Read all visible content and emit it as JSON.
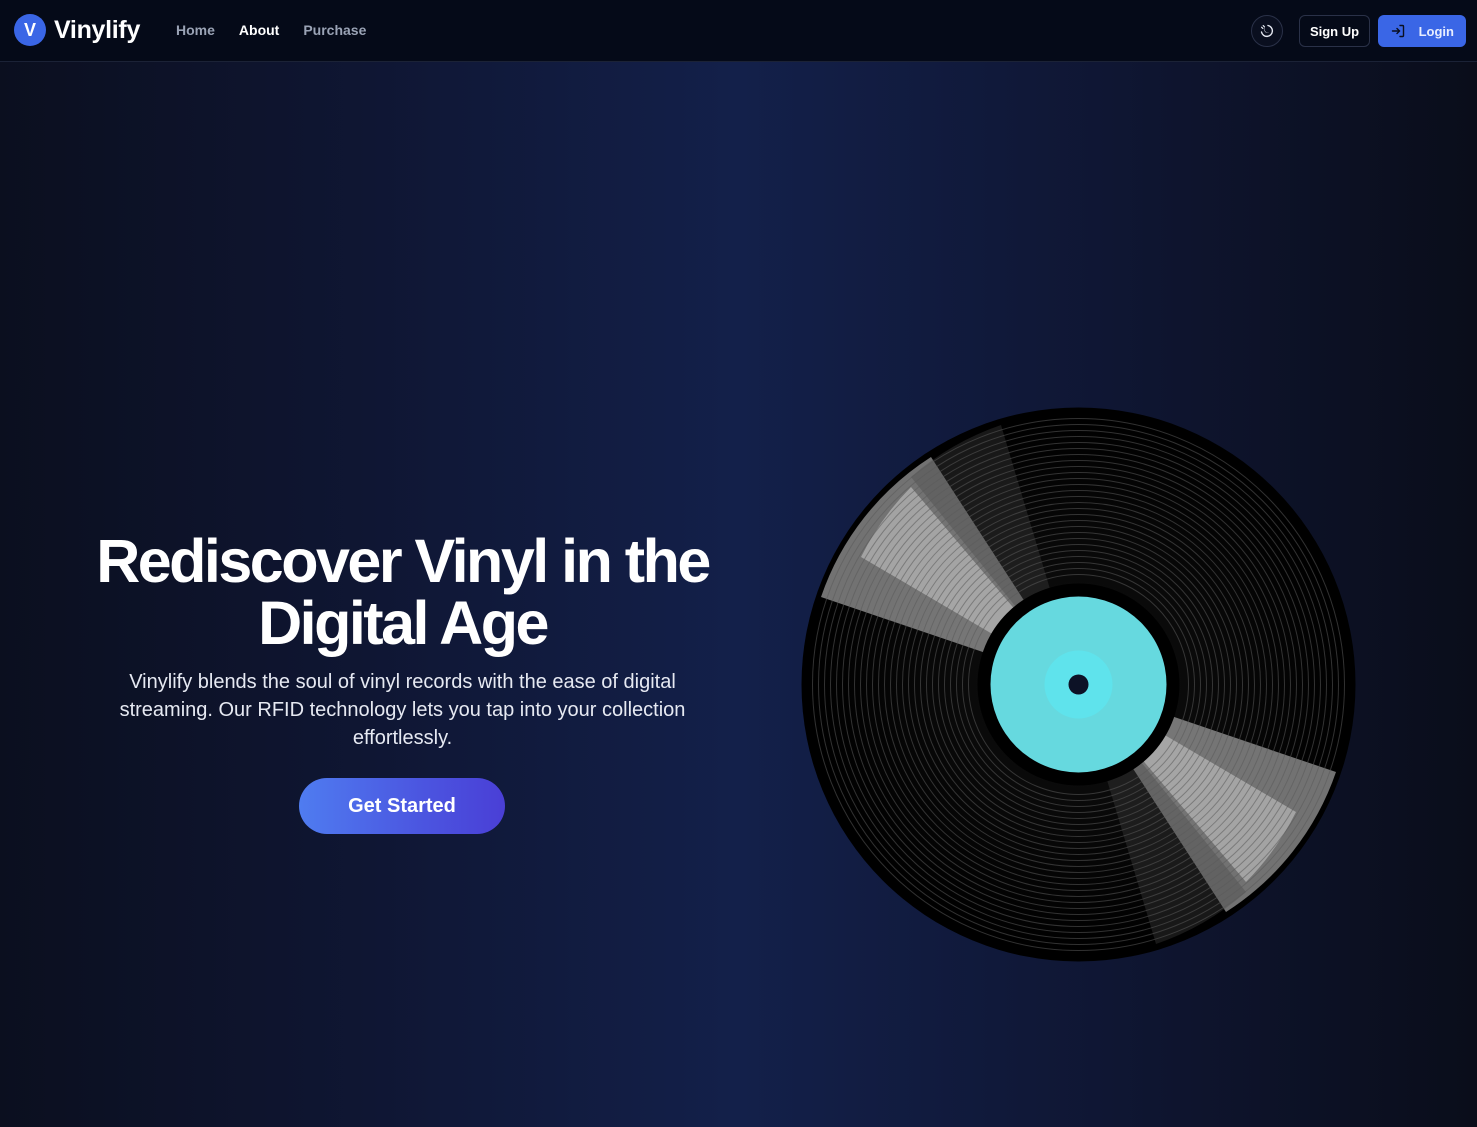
{
  "brand": {
    "badge": "V",
    "name": "Vinylify"
  },
  "nav": {
    "items": [
      {
        "label": "Home",
        "active": false
      },
      {
        "label": "About",
        "active": true
      },
      {
        "label": "Purchase",
        "active": false
      }
    ]
  },
  "header_actions": {
    "theme_toggle_icon": "moon-sun-toggle-icon",
    "signup_label": "Sign Up",
    "login_label": "Login",
    "login_icon": "log-in-icon"
  },
  "hero": {
    "title_line1": "Rediscover Vinyl in the",
    "title_line2": "Digital Age",
    "subtitle": "Vinylify blends the soul of vinyl records with the ease of digital streaming. Our RFID technology lets you tap into your collection effortlessly.",
    "cta_label": "Get Started",
    "image": "vinyl-record-icon"
  },
  "colors": {
    "accent": "#3a66e6",
    "nav_bg": "#050a18",
    "label_teal": "#66d9df",
    "cta_start": "#4f7cf0",
    "cta_end": "#4a3fd6"
  }
}
